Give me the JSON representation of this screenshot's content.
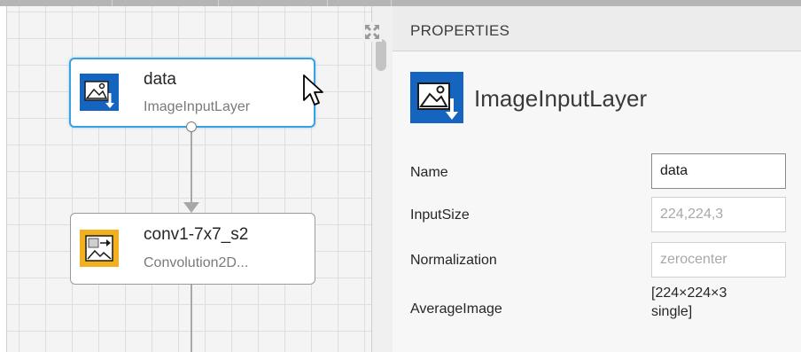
{
  "canvas": {
    "nodes": [
      {
        "title": "data",
        "subtitle": "ImageInputLayer",
        "icon": "image-input-icon",
        "selected": true
      },
      {
        "title": "conv1-7x7_s2",
        "subtitle": "Convolution2D...",
        "icon": "convolution-icon",
        "selected": false
      }
    ]
  },
  "properties": {
    "header": "PROPERTIES",
    "layer_type": "ImageInputLayer",
    "fields": {
      "name": {
        "label": "Name",
        "value": "data"
      },
      "input_size": {
        "label": "InputSize",
        "value": "224,224,3"
      },
      "normalization": {
        "label": "Normalization",
        "value": "zerocenter"
      },
      "average_image": {
        "label": "AverageImage",
        "value_line1": "[224×224×3",
        "value_line2": "single]"
      }
    }
  },
  "colors": {
    "selection": "#3aa0e0",
    "input_icon_bg": "#1565c0",
    "conv_icon_bg": "#f2b01e"
  }
}
